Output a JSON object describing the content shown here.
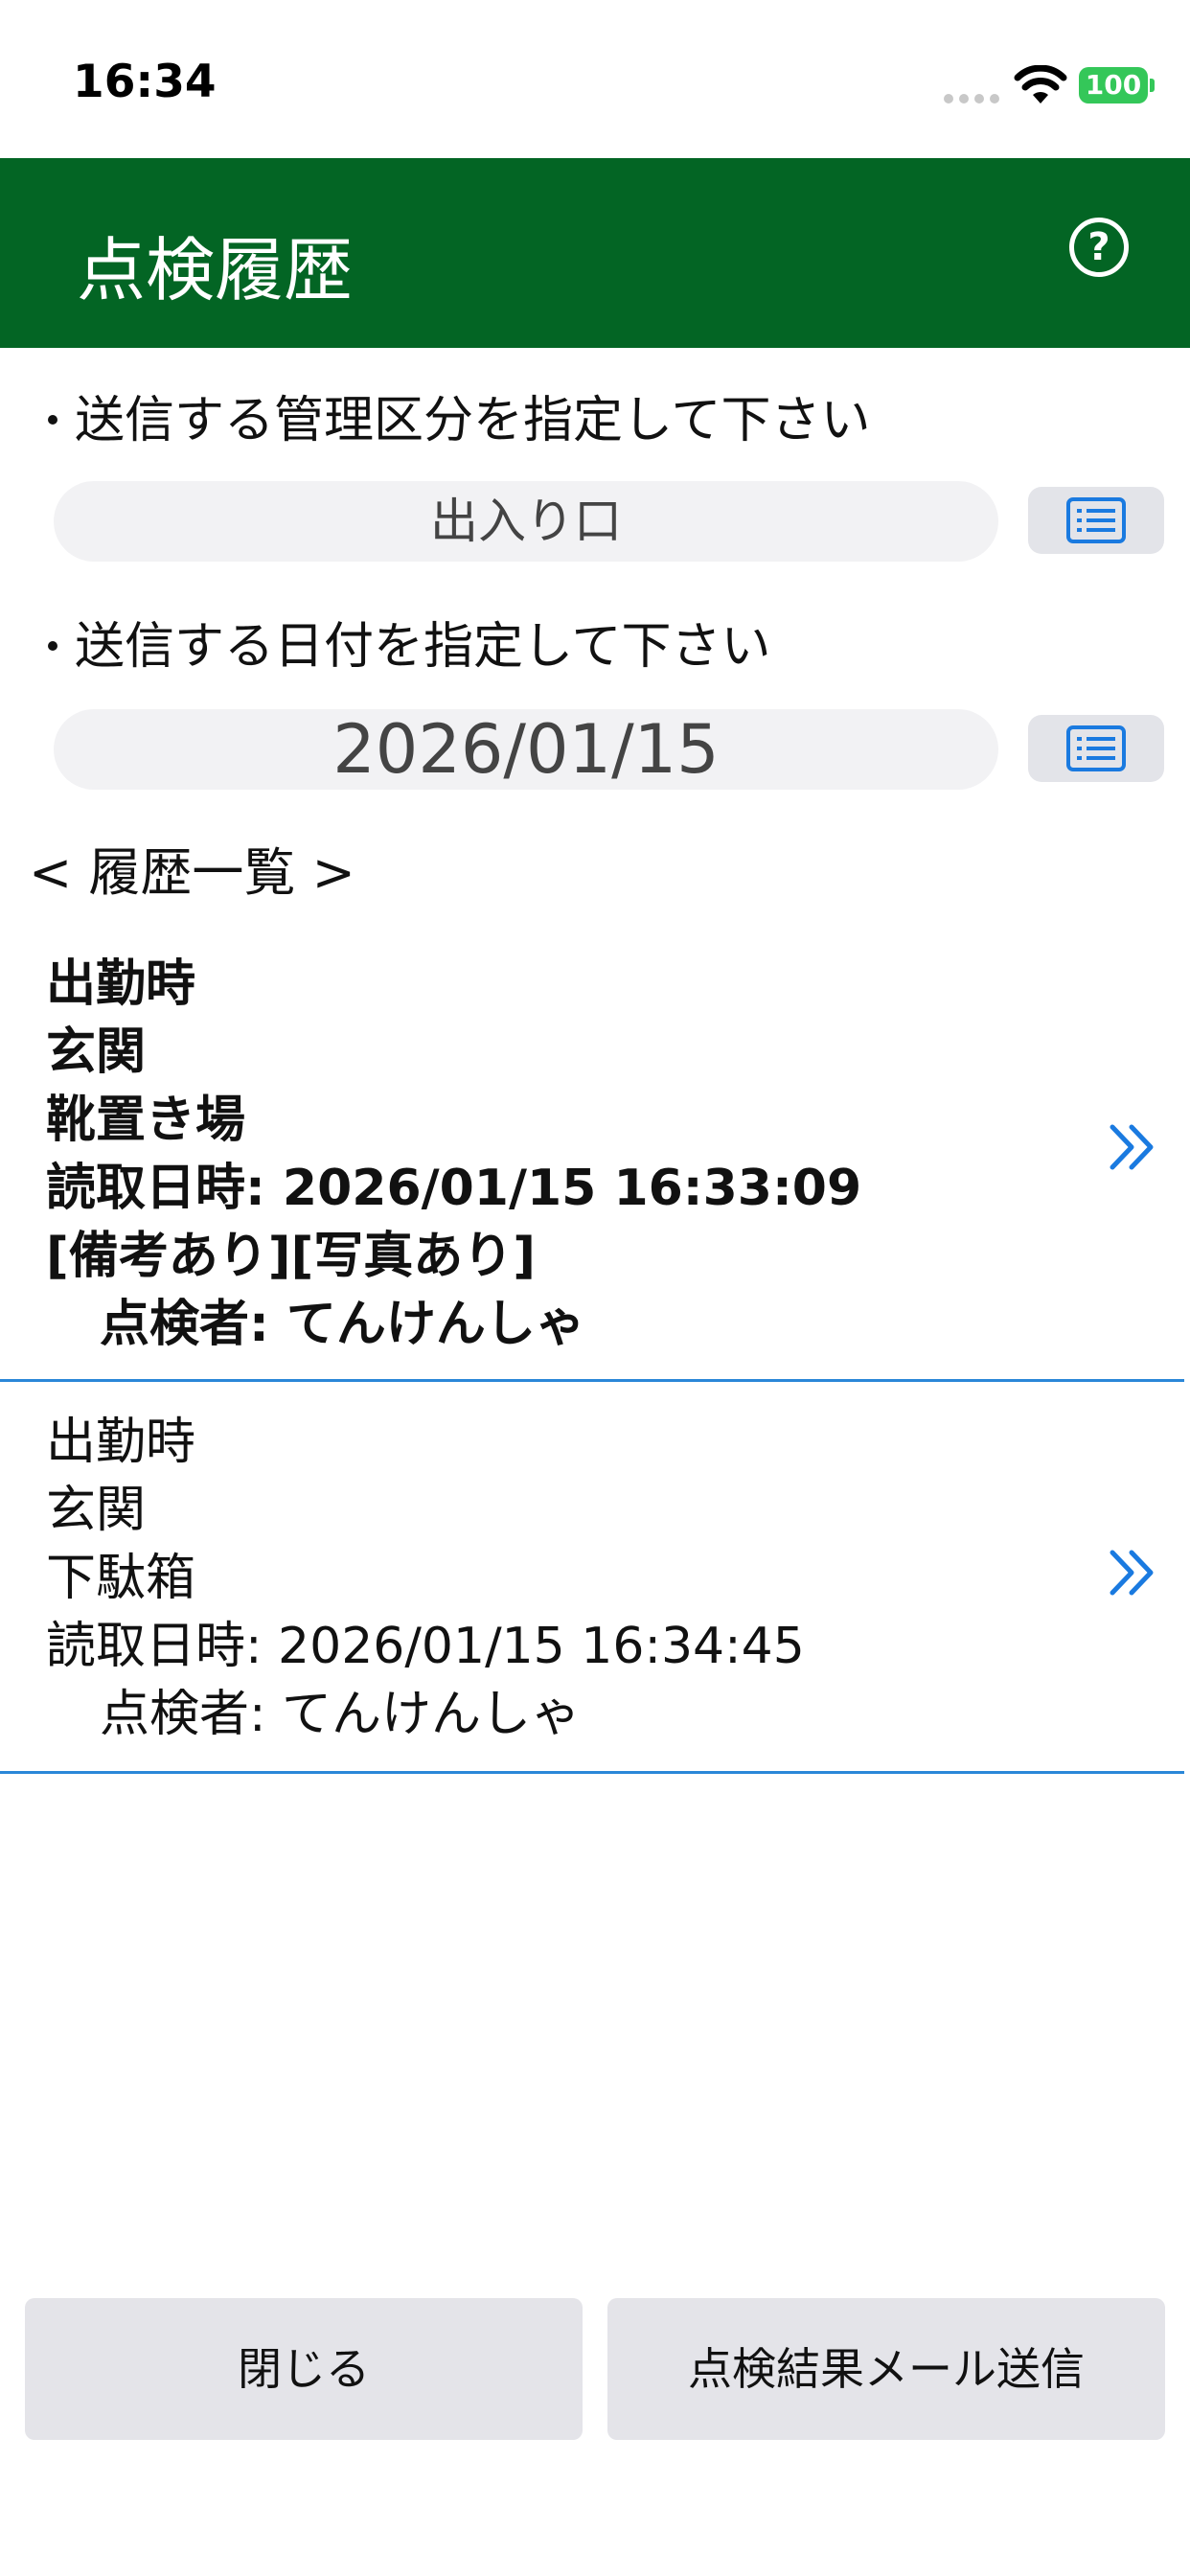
{
  "status_bar": {
    "time": "16:34",
    "battery": "100"
  },
  "header": {
    "title": "点検履歴",
    "help_icon": "?"
  },
  "division": {
    "label": "送信する管理区分を指定して下さい",
    "value": "出入り口",
    "list_icon": "list-icon"
  },
  "date": {
    "label": "送信する日付を指定して下さい",
    "value": "2026/01/15",
    "list_icon": "list-icon"
  },
  "history": {
    "title": "< 履歴一覧 >",
    "items": [
      {
        "line1": "出勤時",
        "line2": "玄関",
        "line3": "靴置き場",
        "read_time": "読取日時: 2026/01/15 16:33:09",
        "notes": "[備考あり][写真あり]",
        "inspector": "点検者: てんけんしゃ"
      },
      {
        "line1": "出勤時",
        "line2": "玄関",
        "line3": "下駄箱",
        "read_time": "読取日時: 2026/01/15 16:34:45",
        "inspector": "点検者: てんけんしゃ"
      }
    ]
  },
  "footer": {
    "close_label": "閉じる",
    "send_label": "点検結果メール送信"
  },
  "colors": {
    "header_bg": "#036524",
    "accent": "#2a87d8",
    "battery": "#34c759"
  }
}
